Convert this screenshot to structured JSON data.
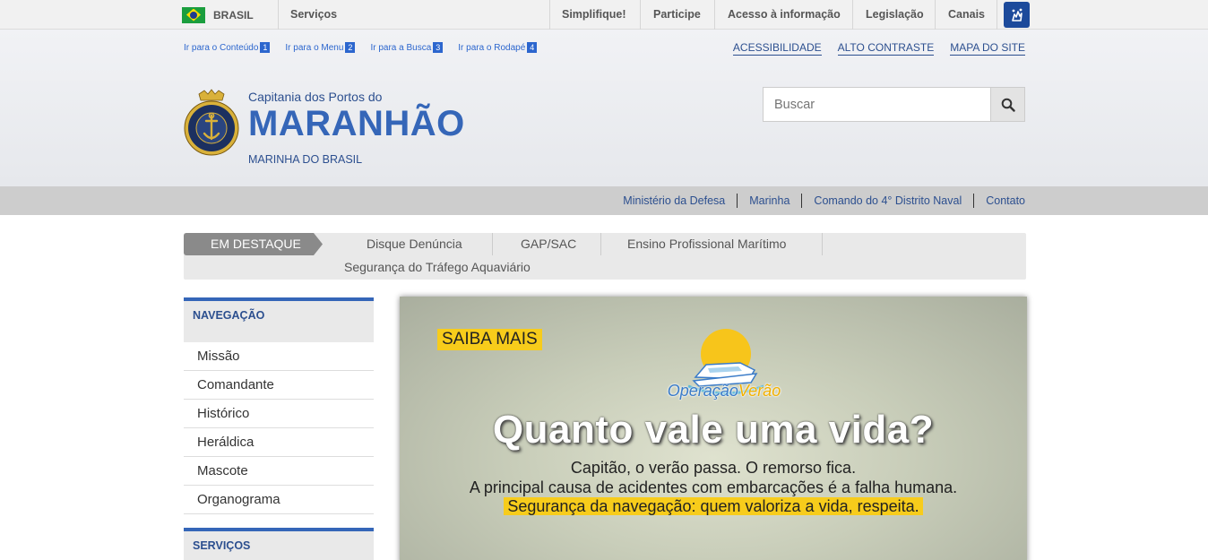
{
  "gov_bar": {
    "country": "BRASIL",
    "links": [
      "Serviços",
      "Simplifique!",
      "Participe",
      "Acesso à informação",
      "Legislação",
      "Canais"
    ]
  },
  "skip_links": [
    {
      "label": "Ir para o Conteúdo",
      "key": "1"
    },
    {
      "label": "Ir para o Menu",
      "key": "2"
    },
    {
      "label": "Ir para a Busca",
      "key": "3"
    },
    {
      "label": "Ir para o Rodapé",
      "key": "4"
    }
  ],
  "accessibility_links": [
    "ACESSIBILIDADE",
    "ALTO CONTRASTE",
    "MAPA DO SITE"
  ],
  "site": {
    "subtitle": "Capitania dos Portos do",
    "title": "MARANHÃO",
    "org": "MARINHA DO BRASIL",
    "logo_text": "MARINHA DO BRASIL"
  },
  "search": {
    "placeholder": "Buscar"
  },
  "service_links": [
    "Ministério da Defesa",
    "Marinha",
    "Comando do 4° Distrito Naval",
    "Contato"
  ],
  "destaque": {
    "label": "EM DESTAQUE",
    "items": [
      "Disque Denúncia",
      "GAP/SAC",
      "Ensino Profissional Marítimo",
      "Segurança do Tráfego Aquaviário"
    ]
  },
  "sidebar": {
    "nav_heading": "NAVEGAÇÃO",
    "nav_items": [
      "Missão",
      "Comandante",
      "Histórico",
      "Heráldica",
      "Mascote",
      "Organograma"
    ],
    "services_heading": "SERVIÇOS"
  },
  "banner": {
    "badge": "SAIBA MAIS",
    "logo_part1": "Operação",
    "logo_part2": "Verão",
    "headline": "Quanto vale uma vida?",
    "line1": "Capitão, o verão passa. O remorso fica.",
    "line2": "A principal causa de acidentes com embarcações é a falha humana.",
    "line3": "Segurança da navegação: quem valoriza a vida, respeita."
  },
  "colors": {
    "accent": "#3566b8",
    "link": "#2c4f8f",
    "highlight": "#f7cc1b"
  }
}
